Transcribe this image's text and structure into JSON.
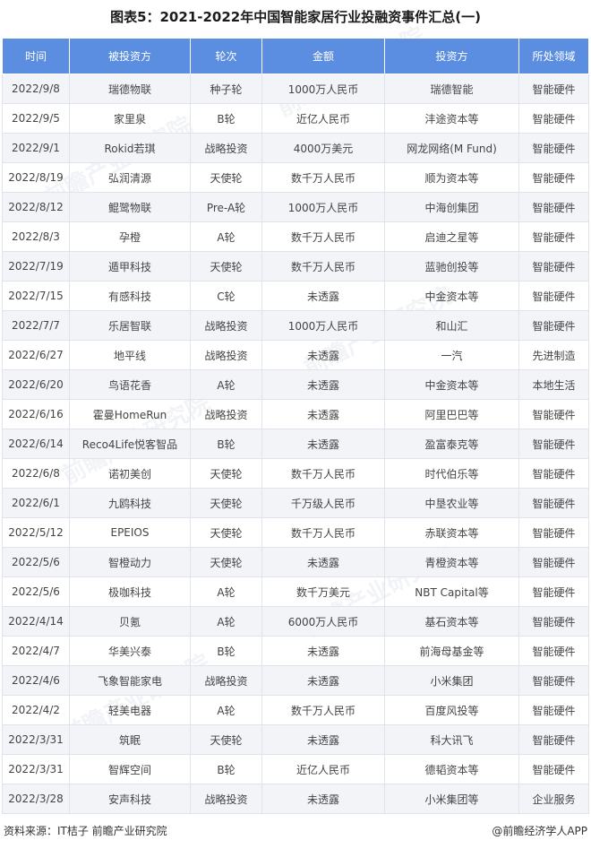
{
  "title": "图表5：2021-2022年中国智能家居行业投融资事件汇总(一)",
  "columns": [
    "时间",
    "被投资方",
    "轮次",
    "金额",
    "投资方",
    "所处领域"
  ],
  "rows": [
    [
      "2022/9/8",
      "瑞德物联",
      "种子轮",
      "1000万人民币",
      "瑞德智能",
      "智能硬件"
    ],
    [
      "2022/9/5",
      "家里泉",
      "B轮",
      "近亿人民币",
      "沣途资本等",
      "智能硬件"
    ],
    [
      "2022/9/1",
      "Rokid若琪",
      "战略投资",
      "4000万美元",
      "网龙网络(M Fund)",
      "智能硬件"
    ],
    [
      "2022/8/19",
      "弘润清源",
      "天使轮",
      "数千万人民币",
      "顺为资本等",
      "智能硬件"
    ],
    [
      "2022/8/12",
      "鲲鹭物联",
      "Pre-A轮",
      "1000万人民币",
      "中海创集团",
      "智能硬件"
    ],
    [
      "2022/8/3",
      "孕橙",
      "A轮",
      "数千万人民币",
      "启迪之星等",
      "智能硬件"
    ],
    [
      "2022/7/19",
      "遁甲科技",
      "天使轮",
      "数千万人民币",
      "蓝驰创投等",
      "智能硬件"
    ],
    [
      "2022/7/15",
      "有感科技",
      "C轮",
      "未透露",
      "中金资本等",
      "智能硬件"
    ],
    [
      "2022/7/7",
      "乐居智联",
      "战略投资",
      "1000万人民币",
      "和山汇",
      "智能硬件"
    ],
    [
      "2022/6/27",
      "地平线",
      "战略投资",
      "未透露",
      "一汽",
      "先进制造"
    ],
    [
      "2022/6/20",
      "鸟语花香",
      "A轮",
      "未透露",
      "中金资本等",
      "本地生活"
    ],
    [
      "2022/6/16",
      "霍曼HomeRun",
      "战略投资",
      "未透露",
      "阿里巴巴等",
      "智能硬件"
    ],
    [
      "2022/6/14",
      "Reco4Life悦客智品",
      "B轮",
      "未透露",
      "盈富泰克等",
      "智能硬件"
    ],
    [
      "2022/6/8",
      "诺初美创",
      "天使轮",
      "数千万人民币",
      "时代伯乐等",
      "智能硬件"
    ],
    [
      "2022/6/1",
      "九鸥科技",
      "天使轮",
      "千万级人民币",
      "中垦农业等",
      "智能硬件"
    ],
    [
      "2022/5/12",
      "EPEIOS",
      "天使轮",
      "数千万人民币",
      "赤联资本等",
      "智能硬件"
    ],
    [
      "2022/5/6",
      "智橙动力",
      "天使轮",
      "未透露",
      "青橙资本等",
      "智能硬件"
    ],
    [
      "2022/5/6",
      "极咖科技",
      "A轮",
      "数千万美元",
      "NBT Capital等",
      "智能硬件"
    ],
    [
      "2022/4/14",
      "贝氪",
      "A轮",
      "6000万人民币",
      "基石资本等",
      "智能硬件"
    ],
    [
      "2022/4/7",
      "华美兴泰",
      "B轮",
      "未透露",
      "前海母基金等",
      "智能硬件"
    ],
    [
      "2022/4/6",
      "飞象智能家电",
      "战略投资",
      "未透露",
      "小米集团",
      "智能硬件"
    ],
    [
      "2022/4/2",
      "轻美电器",
      "A轮",
      "数千万人民币",
      "百度风投等",
      "智能硬件"
    ],
    [
      "2022/3/31",
      "筑眠",
      "天使轮",
      "未透露",
      "科大讯飞",
      "智能硬件"
    ],
    [
      "2022/3/31",
      "智辉空间",
      "B轮",
      "近亿人民币",
      "德韬资本等",
      "智能硬件"
    ],
    [
      "2022/3/28",
      "安声科技",
      "战略投资",
      "未透露",
      "小米集团等",
      "企业服务"
    ]
  ],
  "footer": {
    "source": "资料来源：IT桔子 前瞻产业研究院",
    "brand": "@前瞻经济学人APP"
  },
  "watermark": "前瞻产业研究院",
  "colors": {
    "header_bg": "#5b8ee0",
    "alt_row_bg": "#f2f4f8",
    "border": "#dfe4ec"
  }
}
